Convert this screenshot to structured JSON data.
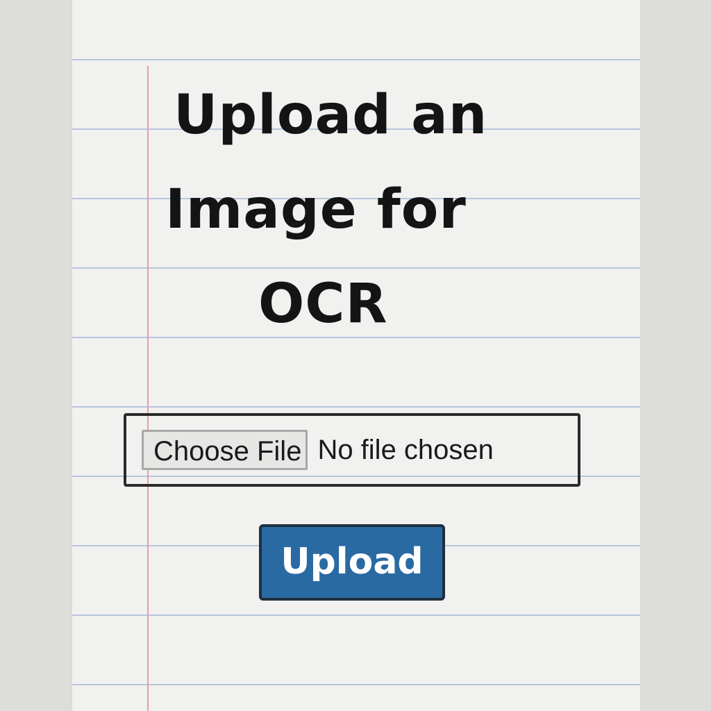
{
  "page": {
    "title_lines": [
      "Upload an",
      "Image for",
      "OCR"
    ]
  },
  "form": {
    "choose_file_label": "Choose File",
    "file_status": "No file chosen",
    "upload_label": "Upload"
  },
  "colors": {
    "paper": "#f1f1ef",
    "rule_line": "#b9c5dd",
    "margin_line": "#e79ca8",
    "upload_button": "#2a6aa3"
  }
}
